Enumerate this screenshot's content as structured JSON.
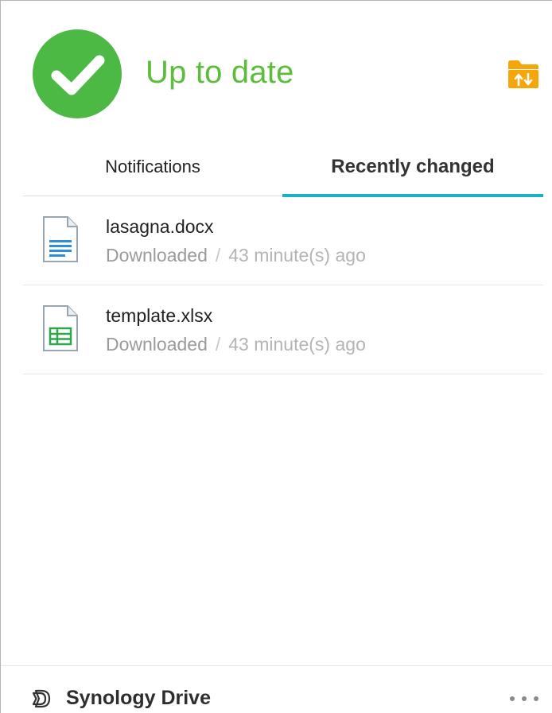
{
  "header": {
    "status_title": "Up to date",
    "status_color": "#5cbd3b",
    "check_color": "#4cb944",
    "folder_icon": "sync-folder-icon",
    "folder_color": "#f5a60a"
  },
  "tabs": [
    {
      "label": "Notifications",
      "active": false
    },
    {
      "label": "Recently changed",
      "active": true
    }
  ],
  "accent_color": "#1ab2c3",
  "files": [
    {
      "name": "lasagna.docx",
      "icon": "word-document-icon",
      "status": "Downloaded",
      "separator": "/",
      "time": "43 minute(s) ago"
    },
    {
      "name": "template.xlsx",
      "icon": "spreadsheet-document-icon",
      "status": "Downloaded",
      "separator": "/",
      "time": "43 minute(s) ago"
    }
  ],
  "footer": {
    "app_name": "Synology Drive",
    "logo_icon": "synology-drive-logo-icon",
    "more_icon": "more-options-icon"
  }
}
